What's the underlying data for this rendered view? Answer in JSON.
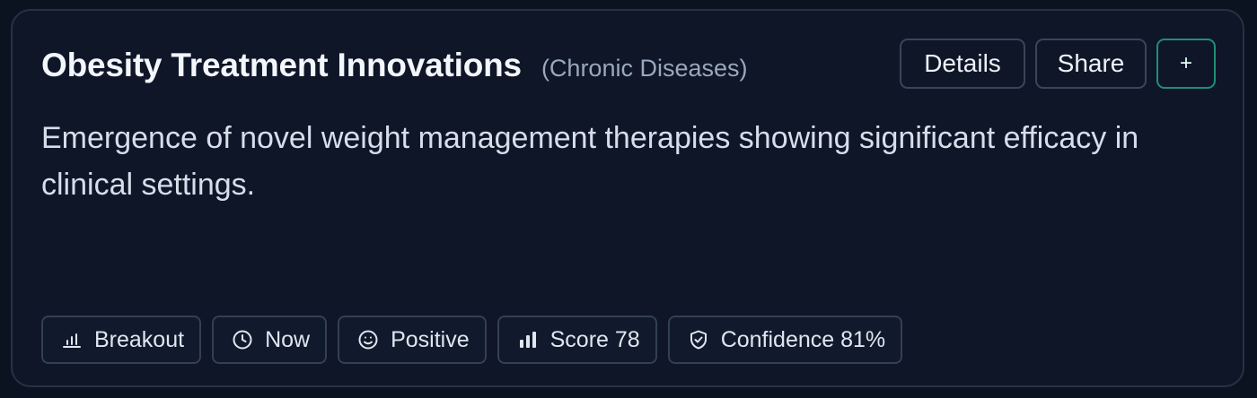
{
  "card": {
    "title": "Obesity Treatment Innovations",
    "category": "(Chronic Diseases)",
    "description": "Emergence of novel weight management therapies showing significant efficacy in clinical settings."
  },
  "actions": {
    "details_label": "Details",
    "share_label": "Share",
    "add_label": "+"
  },
  "chips": [
    {
      "icon": "bar-chart-icon",
      "label": "Breakout"
    },
    {
      "icon": "clock-icon",
      "label": "Now"
    },
    {
      "icon": "smile-icon",
      "label": "Positive"
    },
    {
      "icon": "score-bars-icon",
      "label": "Score 78"
    },
    {
      "icon": "shield-check-icon",
      "label": "Confidence 81%"
    }
  ],
  "colors": {
    "background": "#0b1220",
    "card": "#0e1628",
    "border": "#263244",
    "accent": "#1f8f72",
    "text": "#f3f6fb",
    "muted": "#9aa8bd"
  }
}
